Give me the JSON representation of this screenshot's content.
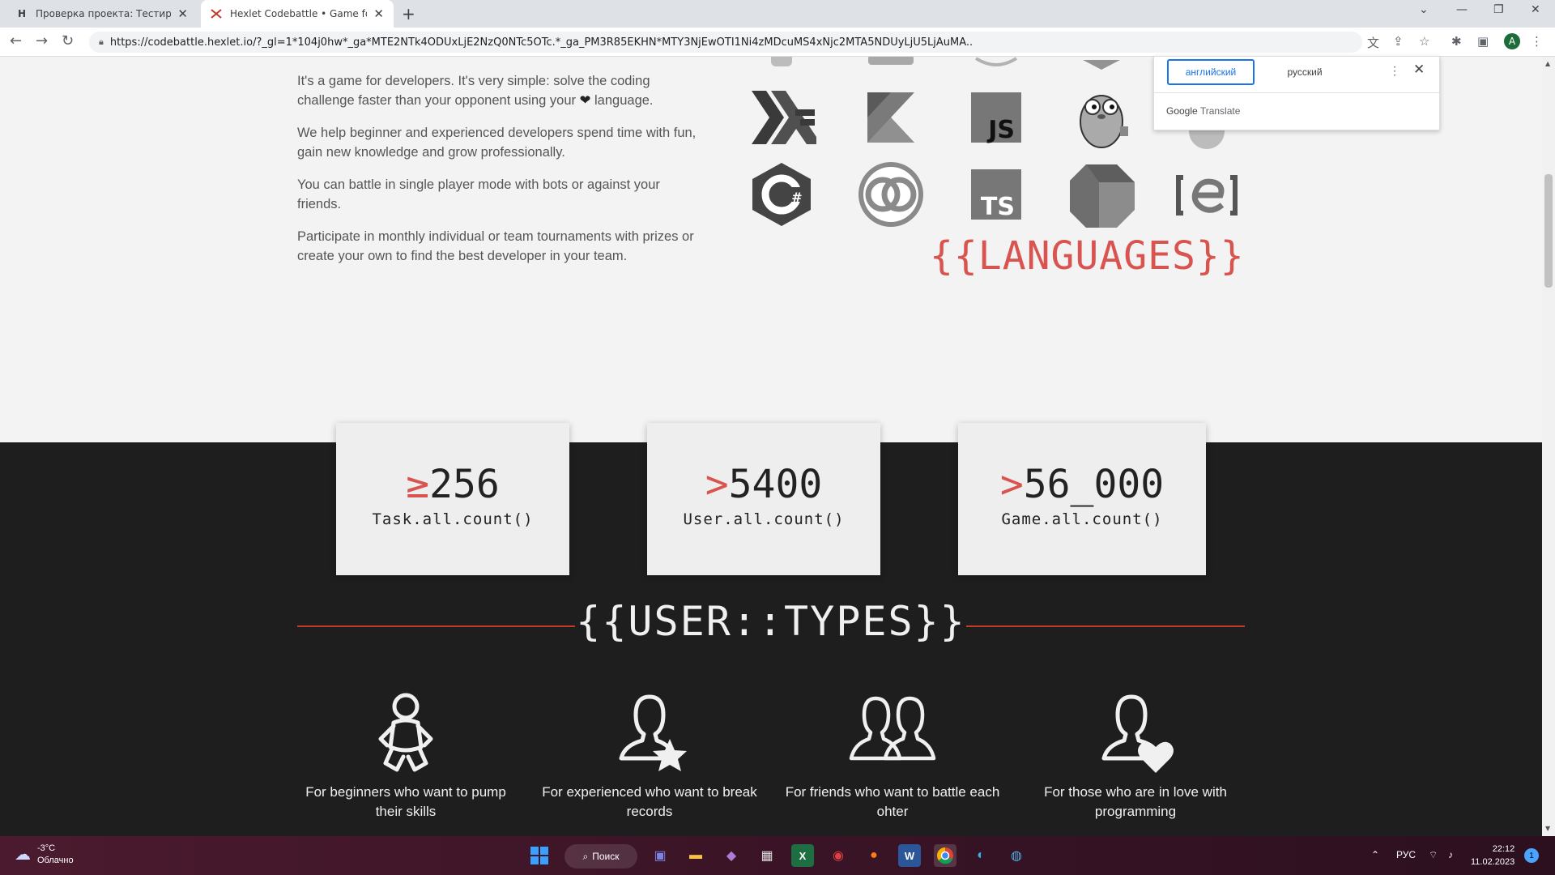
{
  "browser": {
    "tabs": [
      {
        "title": "Проверка проекта: Тестирован…",
        "favicon": "H"
      },
      {
        "title": "Hexlet Codebattle • Game for pro…",
        "favicon": "codebattle-icon"
      }
    ],
    "url": "https://codebattle.hexlet.io/?_gl=1*104j0hw*_ga*MTE2NTk4ODUxLjE2NzQ0NTc5OTc.*_ga_PM3R85EKHN*MTY3NjEwOTI1Ni4zMDcuMS4xNjc2MTA5NDUyLjU5LjAuMA..",
    "profile_initial": "A"
  },
  "translate_popup": {
    "lang_source": "английский",
    "lang_target": "русский",
    "brand_google": "Google",
    "brand_translate": "Translate"
  },
  "intro": {
    "p1_a": "It's a game for developers. It's very simple: solve the coding challenge faster than your opponent using your",
    "p1_heart": "❤",
    "p1_b": "language.",
    "p2": "We help beginner and experienced developers spend time with fun, gain new knowledge and grow professionally.",
    "p3": "You can battle in single player mode with bots or against your friends.",
    "p4": "Participate in monthly individual or team tournaments with prizes or create your own to find the best developer in your team."
  },
  "languages": {
    "title": "{{LANGUAGES}}",
    "icons": [
      "haskell-icon",
      "kotlin-icon",
      "javascript-icon",
      "golang-icon",
      "csharp-icon",
      "clojure-icon",
      "typescript-icon",
      "dart-icon",
      "elixir-icon"
    ],
    "js_label": "JS",
    "ts_label": "TS",
    "cs_label": "C#"
  },
  "stats": [
    {
      "prefix": "≥",
      "value": "256",
      "label": "Task.all.count()"
    },
    {
      "prefix": ">",
      "value": "5400",
      "label": "User.all.count()"
    },
    {
      "prefix": ">",
      "value": "56_000",
      "label": "Game.all.count()"
    }
  ],
  "user_types": {
    "title": "{{USER::TYPES}}",
    "items": [
      {
        "icon": "baby-icon",
        "caption": "For beginners who want to pump their skills"
      },
      {
        "icon": "user-star-icon",
        "caption": "For experienced who want to break records"
      },
      {
        "icon": "two-users-icon",
        "caption": "For friends who want to battle each ohter"
      },
      {
        "icon": "user-heart-icon",
        "caption": "For those who are in love with programming"
      }
    ]
  },
  "taskbar": {
    "temp": "-3°C",
    "weather": "Облачно",
    "search_label": "Поиск",
    "lang": "РУС",
    "time": "22:12",
    "date": "11.02.2023",
    "notifications": "1"
  },
  "colors": {
    "accent_red": "#d9534f",
    "dark_bg": "#1e1e1e",
    "page_bg": "#f3f3f3"
  }
}
